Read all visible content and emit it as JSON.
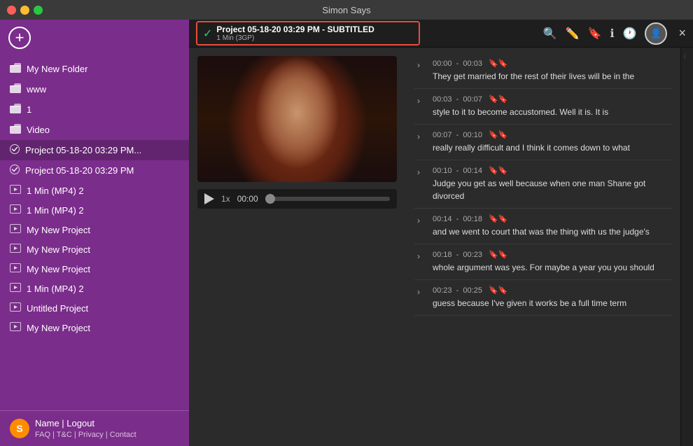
{
  "app": {
    "title": "Simon Says"
  },
  "titlebar": {
    "title": "Simon Says"
  },
  "sidebar": {
    "items": [
      {
        "id": "my-new-folder",
        "icon": "📁",
        "label": "My New Folder",
        "type": "folder"
      },
      {
        "id": "www",
        "icon": "📁",
        "label": "www",
        "type": "folder"
      },
      {
        "id": "1",
        "icon": "📁",
        "label": "1",
        "type": "folder"
      },
      {
        "id": "video",
        "icon": "📁",
        "label": "Video",
        "type": "folder"
      },
      {
        "id": "project-1",
        "icon": "✓",
        "label": "Project 05-18-20 03:29 PM...",
        "type": "project-check",
        "active": true
      },
      {
        "id": "project-2",
        "icon": "✓",
        "label": "Project 05-18-20 03:29 PM",
        "type": "project-check"
      },
      {
        "id": "1min-mp4-1",
        "icon": "🎬",
        "label": "1 Min (MP4) 2",
        "type": "media"
      },
      {
        "id": "1min-mp4-2",
        "icon": "🎬",
        "label": "1 Min (MP4) 2",
        "type": "media"
      },
      {
        "id": "my-new-project-1",
        "icon": "🎬",
        "label": "My New Project",
        "type": "media"
      },
      {
        "id": "my-new-project-2",
        "icon": "🎬",
        "label": "My New Project",
        "type": "media"
      },
      {
        "id": "my-new-project-3",
        "icon": "🎬",
        "label": "My New Project",
        "type": "media"
      },
      {
        "id": "1min-mp4-3",
        "icon": "🎬",
        "label": "1 Min (MP4) 2",
        "type": "media"
      },
      {
        "id": "untitled-project",
        "icon": "🎬",
        "label": "Untitled Project",
        "type": "media"
      },
      {
        "id": "my-new-project-4",
        "icon": "🎬",
        "label": "My New Project",
        "type": "media"
      }
    ],
    "footer": {
      "user_label": "Name | Logout",
      "links": "FAQ | T&C | Privacy | Contact"
    },
    "add_button_label": "+"
  },
  "topbar": {
    "project_title": "Project 05-18-20 03:29 PM - SUBTITLED",
    "project_sub": "1 Min (3GP)",
    "close_label": "×",
    "icons": {
      "search": "🔍",
      "edit": "✏️",
      "bookmark": "🔖",
      "info": "ℹ",
      "history": "🕐"
    }
  },
  "video": {
    "time_display": "00:00",
    "speed": "1x"
  },
  "transcript": {
    "items": [
      {
        "time_start": "00:00",
        "time_end": "00:03",
        "text": "They get married for the rest of their lives will be in the"
      },
      {
        "time_start": "00:03",
        "time_end": "00:07",
        "text": "style to it to become accustomed. Well it is. It is"
      },
      {
        "time_start": "00:07",
        "time_end": "00:10",
        "text": "really really difficult and I think it comes down to what"
      },
      {
        "time_start": "00:10",
        "time_end": "00:14",
        "text": "Judge you get as well because when one man Shane got divorced"
      },
      {
        "time_start": "00:14",
        "time_end": "00:18",
        "text": "and we went to court that was the thing with us the judge's"
      },
      {
        "time_start": "00:18",
        "time_end": "00:23",
        "text": "whole argument was yes. For maybe a year you you should"
      },
      {
        "time_start": "00:23",
        "time_end": "00:25",
        "text": "guess because I've given it works be a full time term"
      }
    ]
  }
}
